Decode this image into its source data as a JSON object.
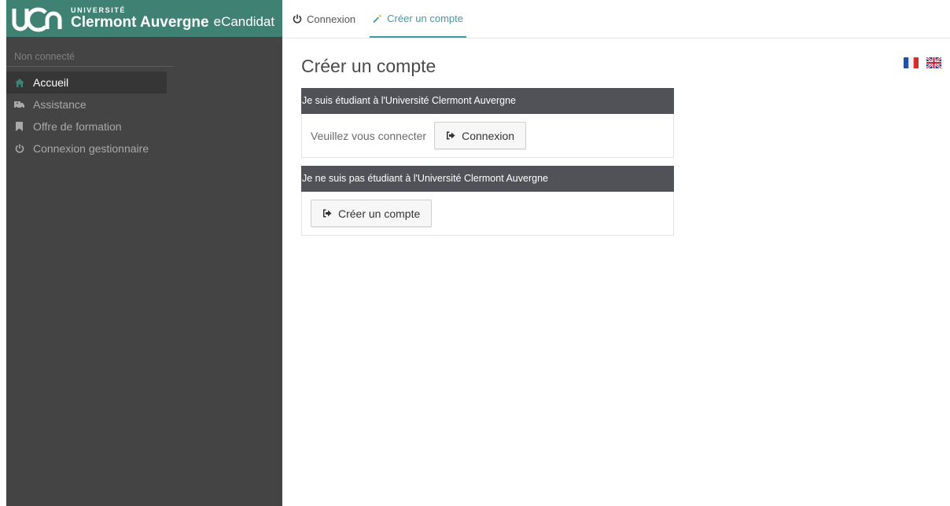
{
  "brand": {
    "university_top": "UNIVERSITÉ",
    "university_name": "Clermont Auvergne",
    "app_name": "eCandidat",
    "logo_text": "UCA"
  },
  "sidebar": {
    "user_status": "Non connecté",
    "items": [
      {
        "label": "Accueil",
        "icon": "home-icon",
        "active": true
      },
      {
        "label": "Assistance",
        "icon": "ambulance-icon",
        "active": false
      },
      {
        "label": "Offre de formation",
        "icon": "bookmark-icon",
        "active": false
      },
      {
        "label": "Connexion gestionnaire",
        "icon": "power-icon",
        "active": false
      }
    ]
  },
  "topbar": {
    "tabs": [
      {
        "label": "Connexion",
        "icon": "power-icon",
        "active": false
      },
      {
        "label": "Créer un compte",
        "icon": "magic-wand-icon",
        "active": true
      }
    ]
  },
  "main": {
    "title": "Créer un compte",
    "panel_student": {
      "heading": "Je suis étudiant à l'Université Clermont Auvergne",
      "hint": "Veuillez vous connecter",
      "button_label": "Connexion"
    },
    "panel_external": {
      "heading": "Je ne suis pas étudiant à l'Université Clermont Auvergne",
      "button_label": "Créer un compte"
    }
  },
  "languages": [
    "fr-flag-icon",
    "en-flag-icon"
  ],
  "colors": {
    "brand_green": "#3f8173",
    "sidebar_bg": "#444444",
    "accent": "#3e9aa8",
    "panel_header": "#515258"
  }
}
